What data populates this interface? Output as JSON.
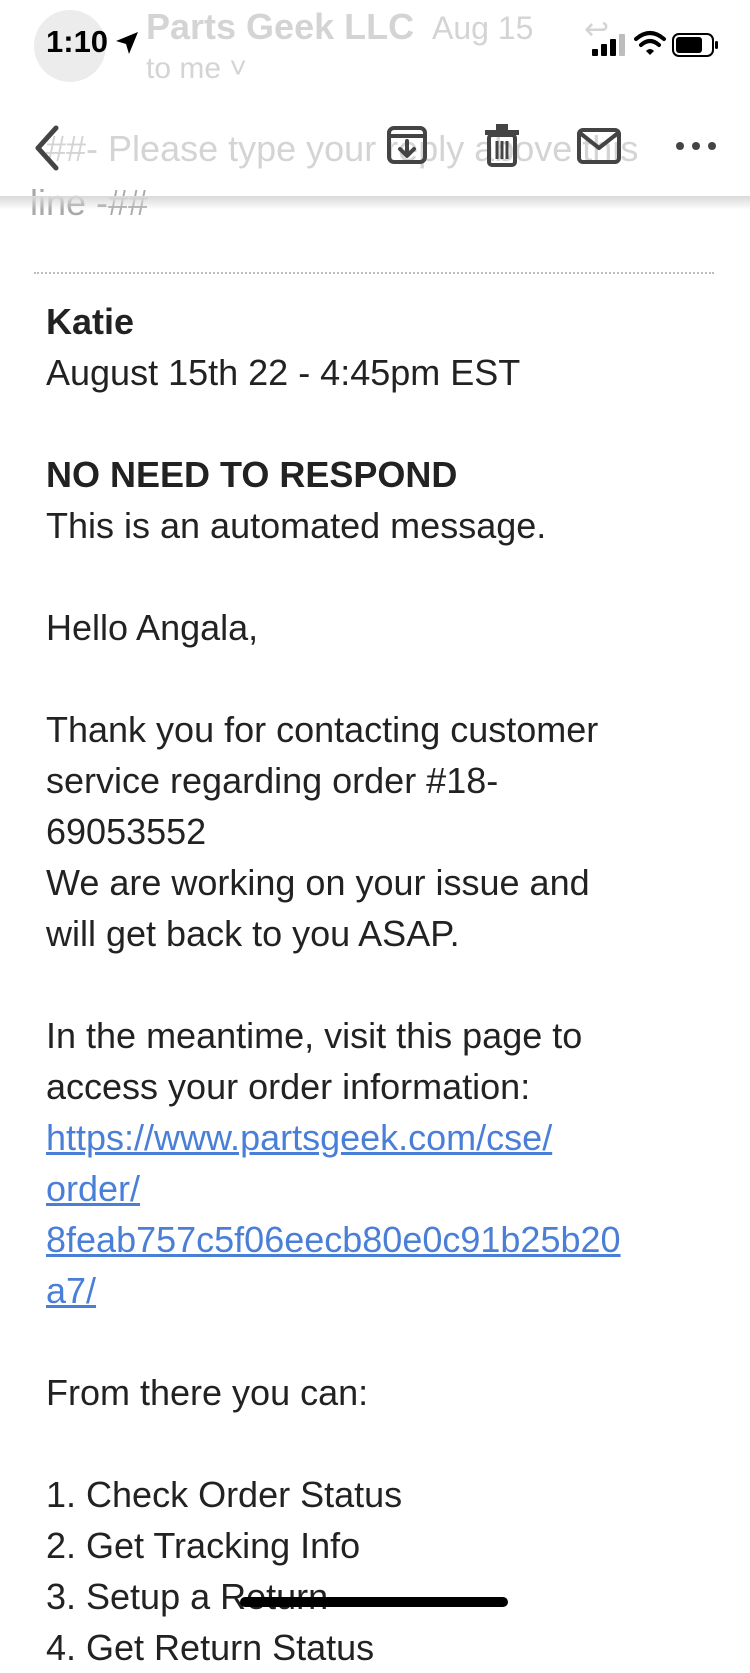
{
  "status_bar": {
    "time": "1:10",
    "icons": [
      "location-arrow-icon",
      "cellular-signal-icon",
      "wifi-icon",
      "battery-icon"
    ]
  },
  "faded_header": {
    "sender": "Parts Geek LLC",
    "date": "Aug 15",
    "recipient": "to me ˅",
    "body_line1": "##- Please type your reply above this",
    "body_line2": "line -##"
  },
  "toolbar": {
    "icons": [
      "back-chevron-icon",
      "archive-icon",
      "trash-icon",
      "mail-icon",
      "more-icon"
    ]
  },
  "email": {
    "agent_name": "Katie",
    "timestamp": "August 15th 22 - 4:45pm EST",
    "notice_heading": "NO NEED TO RESPOND",
    "notice_text": "This is an automated message.",
    "greeting": "Hello Angala,",
    "para1": [
      "Thank you for contacting customer",
      "service regarding order #18-",
      "69053552",
      "We are working on your issue and",
      "will get back to you ASAP."
    ],
    "para2": [
      "In the meantime, visit this page to",
      "access your order information:"
    ],
    "link_lines": [
      "https://www.partsgeek.com/cse/",
      "order/",
      "8feab757c5f06eecb80e0c91b25b20",
      "a7/"
    ],
    "options_intro": "From there you can:",
    "options": [
      "1. Check Order Status",
      "2. Get Tracking Info",
      "3. Setup a Return",
      "4. Get Return Status"
    ]
  },
  "colors": {
    "link": "#4a7fd7",
    "text": "#222222",
    "faded": "#d4d4d4"
  }
}
